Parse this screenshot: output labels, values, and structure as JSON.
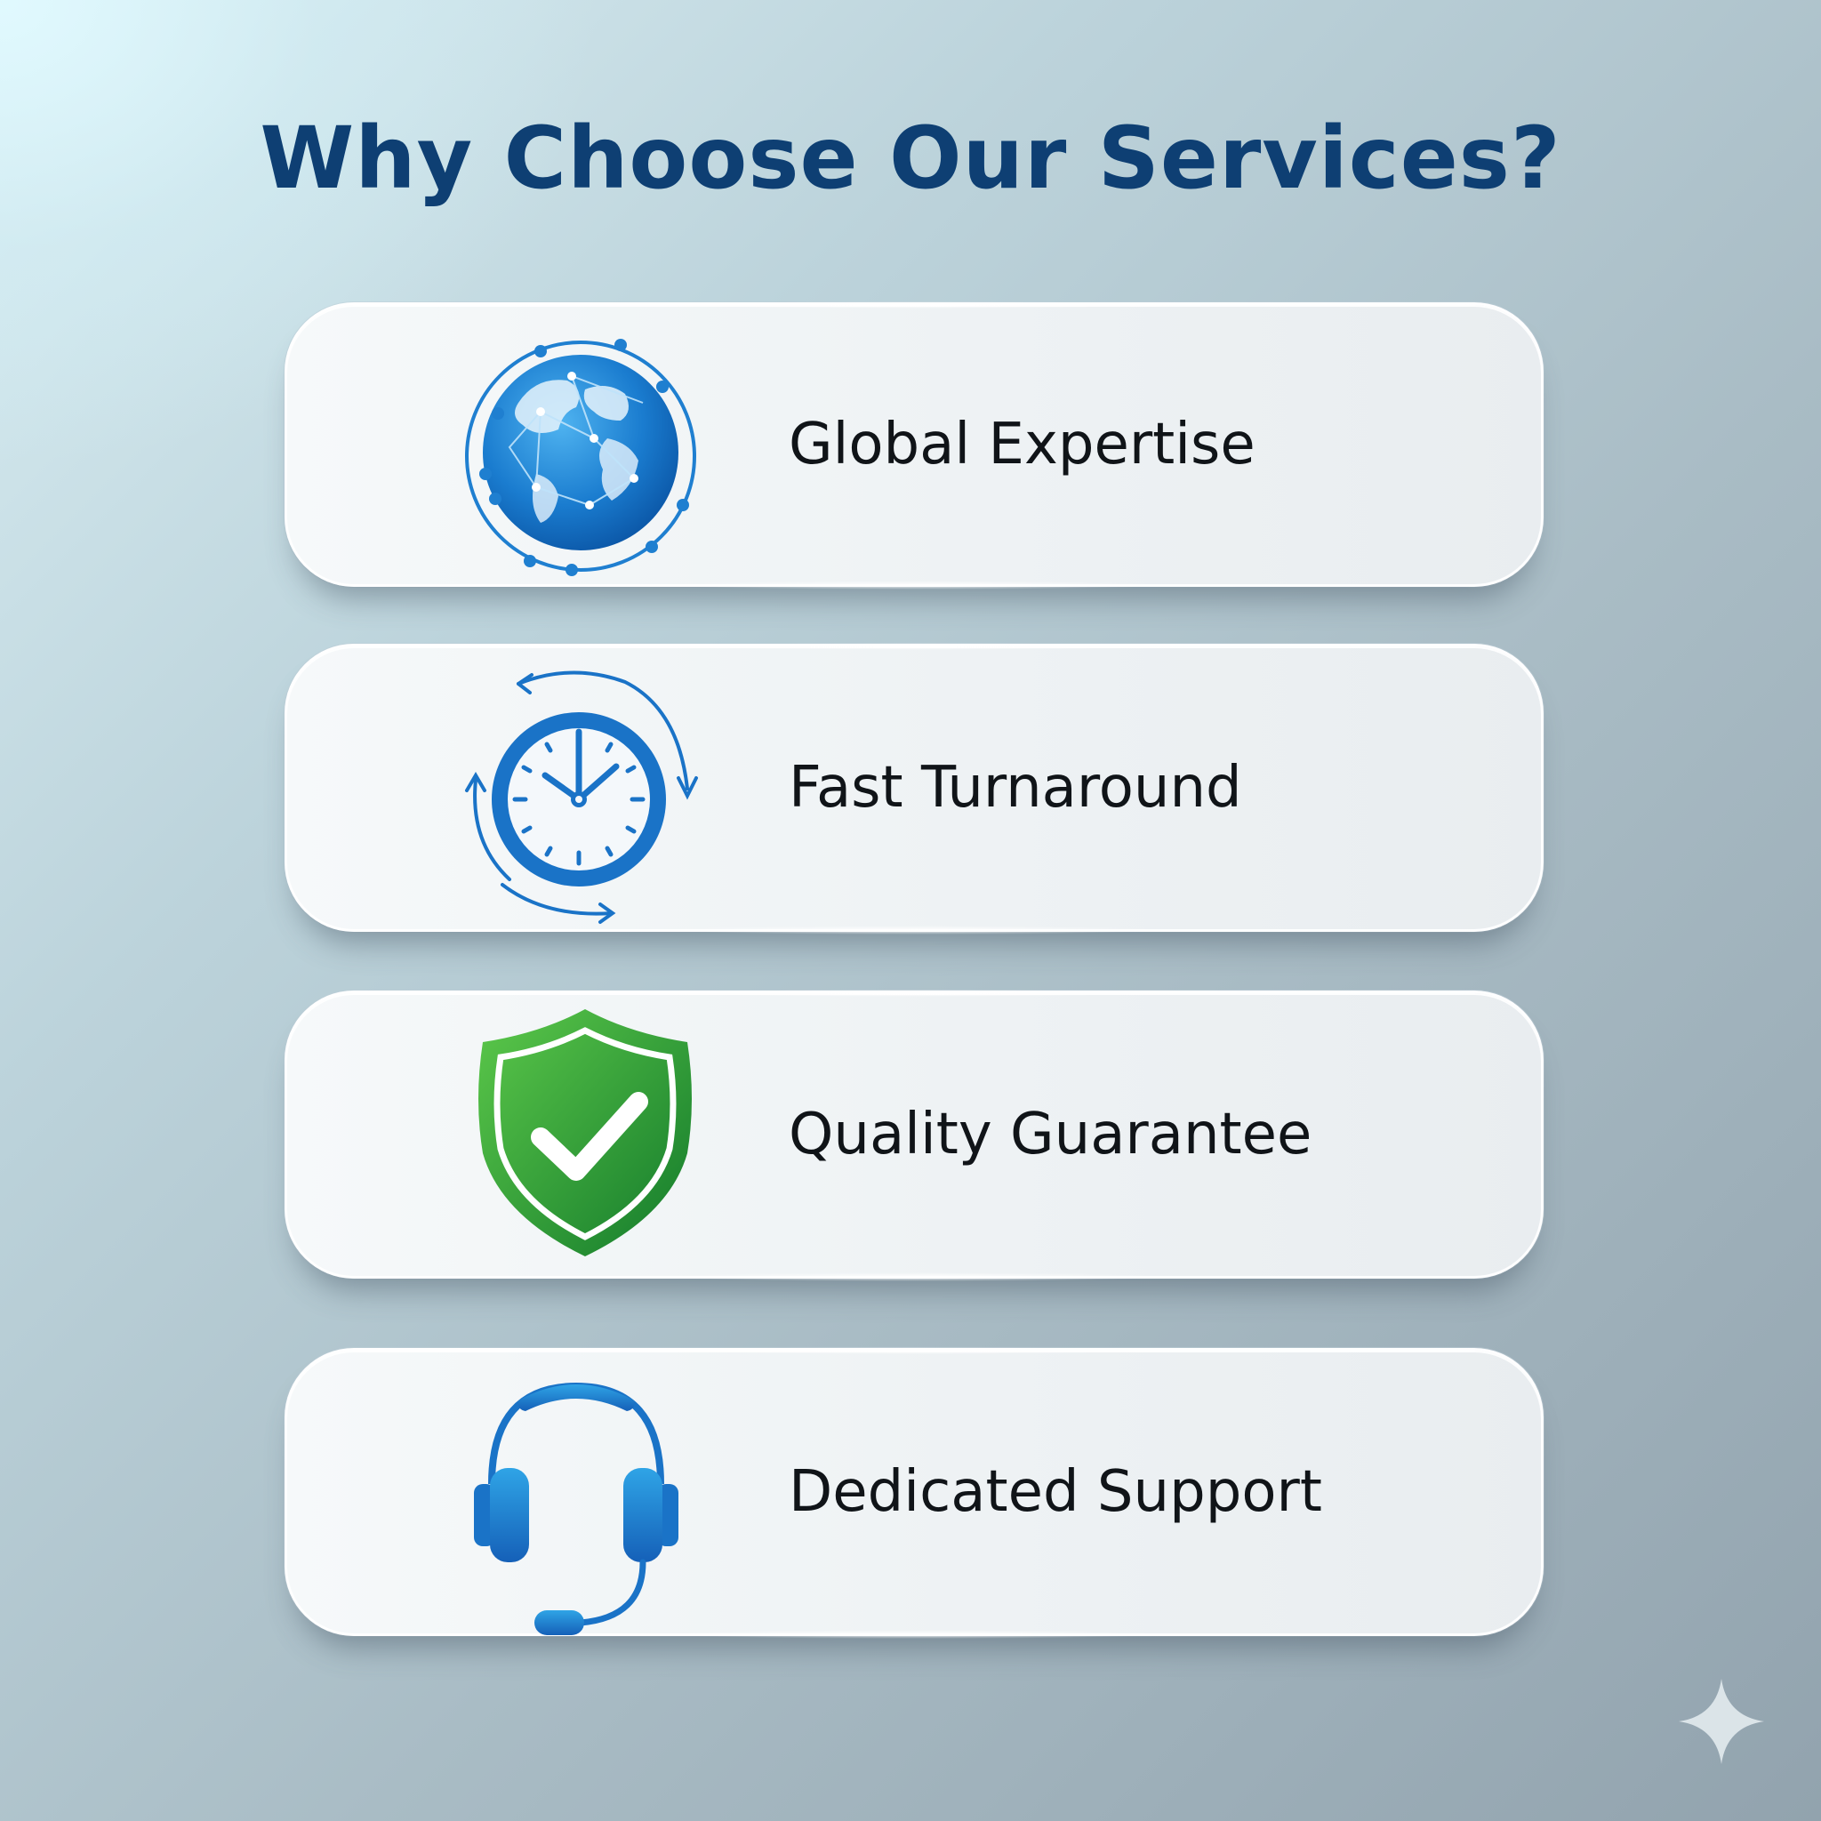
{
  "page": {
    "title": "Why Choose Our Services?"
  },
  "features": [
    {
      "label": "Global Expertise",
      "icon": "globe-network-icon"
    },
    {
      "label": "Fast Turnaround",
      "icon": "clock-refresh-icon"
    },
    {
      "label": "Quality Guarantee",
      "icon": "shield-check-icon"
    },
    {
      "label": "Dedicated Support",
      "icon": "headset-icon"
    }
  ],
  "colors": {
    "title": "#0e3f73",
    "accent_blue": "#1a73c7",
    "accent_green": "#2e9e3a",
    "label_text": "#101418"
  }
}
